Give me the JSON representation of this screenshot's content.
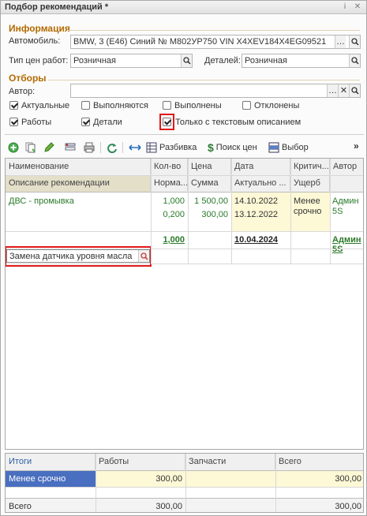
{
  "window": {
    "title": "Подбор рекомендаций *"
  },
  "info": {
    "section": "Информация",
    "car_label": "Автомобиль:",
    "car_value": "BMW, 3 (E46) Синий № М802УР750 VIN X4XEV184X4EG09521",
    "work_price_label": "Тип цен работ:",
    "work_price_value": "Розничная",
    "parts_label": "Деталей:",
    "parts_value": "Розничная"
  },
  "filters": {
    "section": "Отборы",
    "author_label": "Автор:",
    "author_value": "",
    "checkboxes": [
      {
        "label": "Актуальные",
        "checked": true
      },
      {
        "label": "Выполняются",
        "checked": false
      },
      {
        "label": "Выполнены",
        "checked": false
      },
      {
        "label": "Отклонены",
        "checked": false
      },
      {
        "label": "Работы",
        "checked": true
      },
      {
        "label": "Детали",
        "checked": true
      },
      {
        "label": "Только с текстовым описанием",
        "checked": true
      }
    ]
  },
  "toolbar": {
    "split_label": "Разбивка",
    "price_search_label": "Поиск цен",
    "select_label": "Выбор"
  },
  "grid": {
    "headers_row1": [
      "Наименование",
      "Кол-во",
      "Цена",
      "Дата",
      "Критич...",
      "Автор"
    ],
    "headers_row2": [
      "Описание рекомендации",
      "Норма...",
      "Сумма",
      "Актуально ...",
      "Ущерб"
    ],
    "row": {
      "name": "ДВС - промывка",
      "qty1": "1,000",
      "price1": "1 500,00",
      "date1": "14.10.2022",
      "crit": "Менее срочно",
      "author": "Админ 5S",
      "qty2": "0,200",
      "sum2": "300,00",
      "date2": "13.12.2022"
    },
    "total_row": {
      "qty": "1,000",
      "date": "10.04.2024",
      "author": "Админ 5S"
    },
    "edit_value": "Замена датчика уровня масла"
  },
  "footer": {
    "headers": [
      "Итоги",
      "Работы",
      "Запчасти",
      "Всего"
    ],
    "row1": {
      "label": "Менее срочно",
      "works": "300,00",
      "parts": "",
      "total": "300,00"
    },
    "row2": {
      "label": "Всего",
      "works": "300,00",
      "parts": "",
      "total": "300,00"
    }
  },
  "colors": {
    "section": "#b36b00",
    "highlight": "#e01818",
    "green_text": "#2a7a2a",
    "selected_row": "#4a6fc0"
  }
}
